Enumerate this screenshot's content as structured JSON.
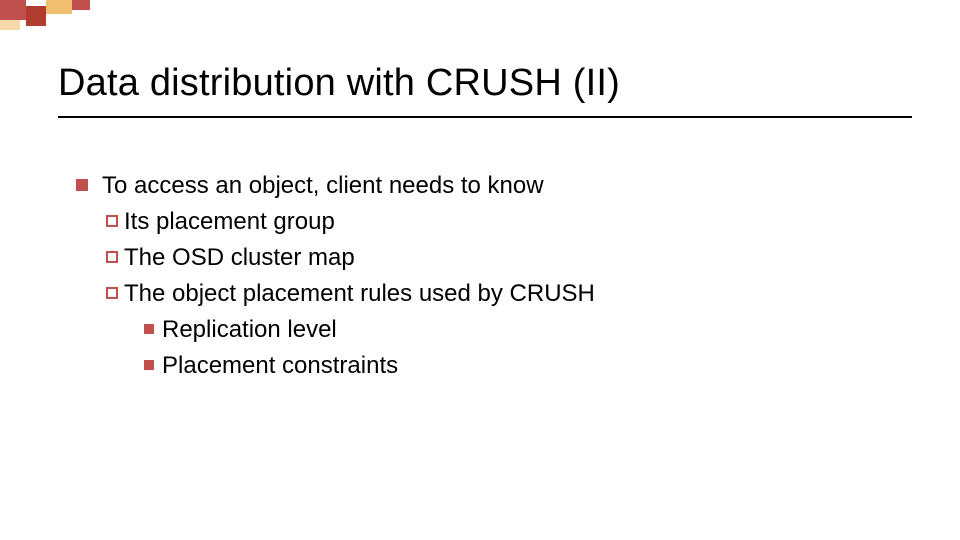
{
  "title": "Data distribution with CRUSH (II)",
  "bullets": {
    "main": "To access an object, client needs to know",
    "sub1": "Its placement group",
    "sub2": "The OSD cluster map",
    "sub3": "The object placement rules used by CRUSH",
    "sub3a": "Replication level",
    "sub3b": "Placement constraints"
  },
  "colors": {
    "accent": "#c0504d"
  }
}
